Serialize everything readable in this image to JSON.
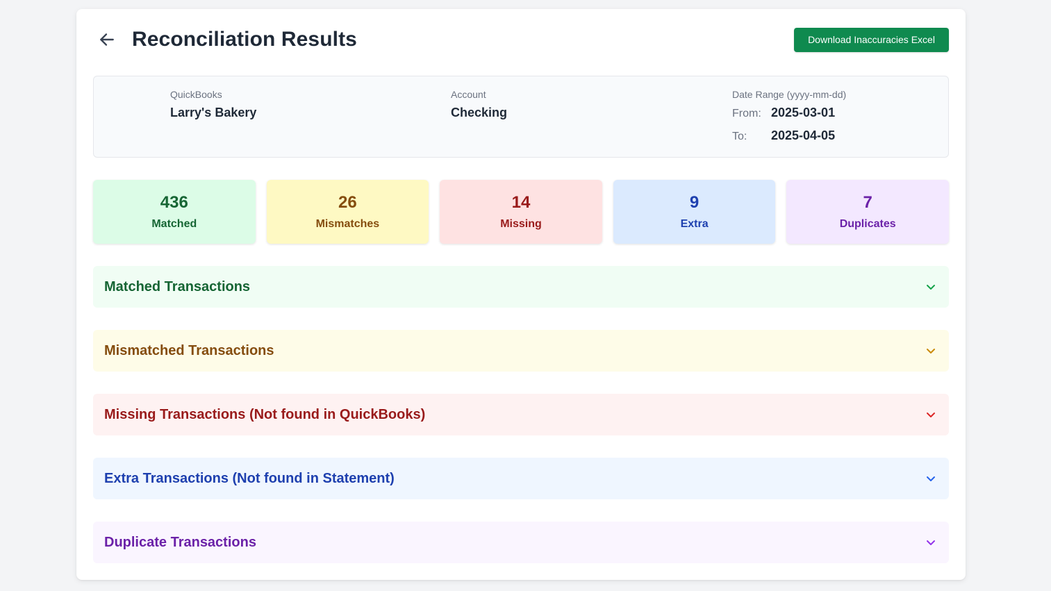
{
  "header": {
    "title": "Reconciliation Results",
    "download_label": "Download Inaccuracies Excel"
  },
  "info": {
    "quickbooks_label": "QuickBooks",
    "quickbooks_value": "Larry's Bakery",
    "account_label": "Account",
    "account_value": "Checking",
    "date_range_label": "Date Range (yyyy-mm-dd)",
    "from_label": "From:",
    "from_value": "2025-03-01",
    "to_label": "To:",
    "to_value": "2025-04-05"
  },
  "stats": [
    {
      "value": "436",
      "label": "Matched",
      "color": "#166534",
      "bg": "#dcfce7"
    },
    {
      "value": "26",
      "label": "Mismatches",
      "color": "#854d0e",
      "bg": "#fef9c3"
    },
    {
      "value": "14",
      "label": "Missing",
      "color": "#991b1b",
      "bg": "#fee2e2"
    },
    {
      "value": "9",
      "label": "Extra",
      "color": "#1e40af",
      "bg": "#dbeafe"
    },
    {
      "value": "7",
      "label": "Duplicates",
      "color": "#6b21a8",
      "bg": "#f3e8ff"
    }
  ],
  "sections": [
    {
      "title": "Matched Transactions",
      "color": "#166534",
      "bg": "#f0fdf4",
      "chevron": "#16a34a"
    },
    {
      "title": "Mismatched Transactions",
      "color": "#854d0e",
      "bg": "#fefce8",
      "chevron": "#ca8a04"
    },
    {
      "title": "Missing Transactions (Not found in QuickBooks)",
      "color": "#991b1b",
      "bg": "#fef2f2",
      "chevron": "#dc2626"
    },
    {
      "title": "Extra Transactions (Not found in Statement)",
      "color": "#1e40af",
      "bg": "#eff6ff",
      "chevron": "#2563eb"
    },
    {
      "title": "Duplicate Transactions",
      "color": "#6b21a8",
      "bg": "#faf5ff",
      "chevron": "#9333ea"
    }
  ],
  "icons": {
    "back": "arrow-left-icon",
    "expand": "chevron-down-icon"
  }
}
